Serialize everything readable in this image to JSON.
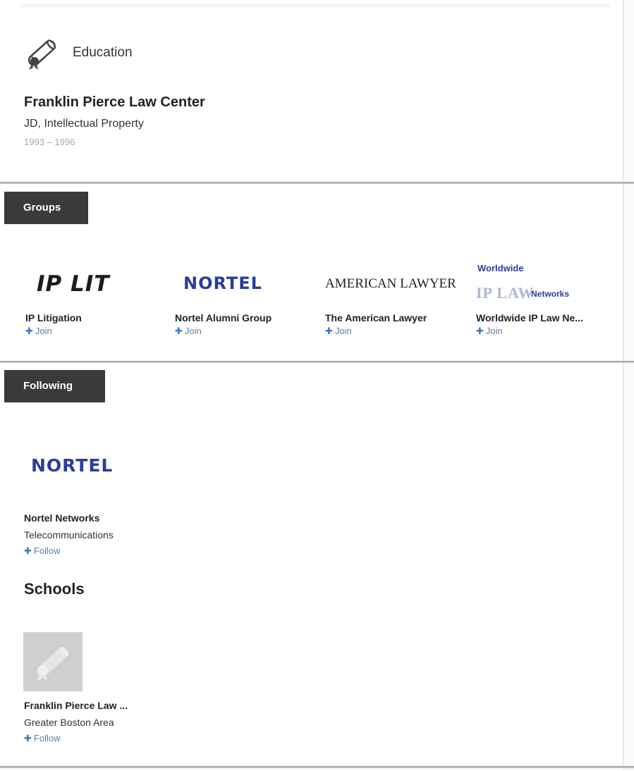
{
  "education": {
    "title": "Education",
    "school": "Franklin Pierce Law Center",
    "degree": "JD, Intellectual Property",
    "dates": "1993 – 1996"
  },
  "groups": {
    "tab_label": "Groups",
    "items": [
      {
        "logo_text": "IP LIT",
        "name": "IP Litigation",
        "action": "Join"
      },
      {
        "logo_text": "NORTEL",
        "name": "Nortel Alumni Group",
        "action": "Join"
      },
      {
        "logo_text": "AMERICAN LAWYER",
        "name": "The American Lawyer",
        "action": "Join"
      },
      {
        "logo_text": "Worldwide IP LAW Networks",
        "name": "Worldwide IP Law Ne...",
        "action": "Join"
      }
    ]
  },
  "following": {
    "tab_label": "Following",
    "company": {
      "logo_text": "NORTEL",
      "name": "Nortel Networks",
      "industry": "Telecommunications",
      "action": "Follow"
    }
  },
  "schools": {
    "title": "Schools",
    "item": {
      "name": "Franklin Pierce Law ...",
      "location": "Greater Boston Area",
      "action": "Follow"
    }
  }
}
